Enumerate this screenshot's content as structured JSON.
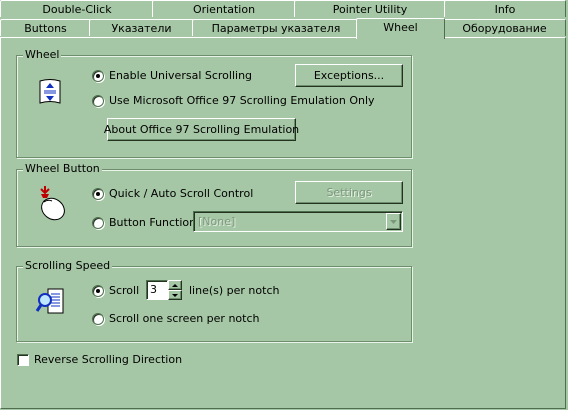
{
  "tabs_back": [
    {
      "label": "Double-Click"
    },
    {
      "label": "Orientation"
    },
    {
      "label": "Pointer Utility"
    },
    {
      "label": "Info"
    }
  ],
  "tabs_front": [
    {
      "label": "Buttons"
    },
    {
      "label": "Указатели"
    },
    {
      "label": "Параметры указателя"
    },
    {
      "label": "Wheel"
    },
    {
      "label": "Оборудование"
    }
  ],
  "active_tab": "Wheel",
  "wheel": {
    "title": "Wheel",
    "enable_universal": "Enable Universal Scrolling",
    "use_office97": "Use Microsoft Office 97 Scrolling Emulation Only",
    "exceptions_button": "Exceptions...",
    "about_button": "About Office 97 Scrolling Emulation",
    "selected": "enable_universal"
  },
  "wheel_button": {
    "title": "Wheel Button",
    "quick_auto": "Quick / Auto Scroll Control",
    "button_function": "Button Function",
    "settings_button": "Settings",
    "function_value": "[None]",
    "selected": "quick_auto"
  },
  "scrolling_speed": {
    "title": "Scrolling Speed",
    "scroll_label": "Scroll",
    "scroll_value": "3",
    "lines_per_notch": "line(s) per notch",
    "one_screen": "Scroll one screen per notch",
    "selected": "scroll_lines"
  },
  "reverse": {
    "label": "Reverse Scrolling Direction",
    "checked": false
  }
}
